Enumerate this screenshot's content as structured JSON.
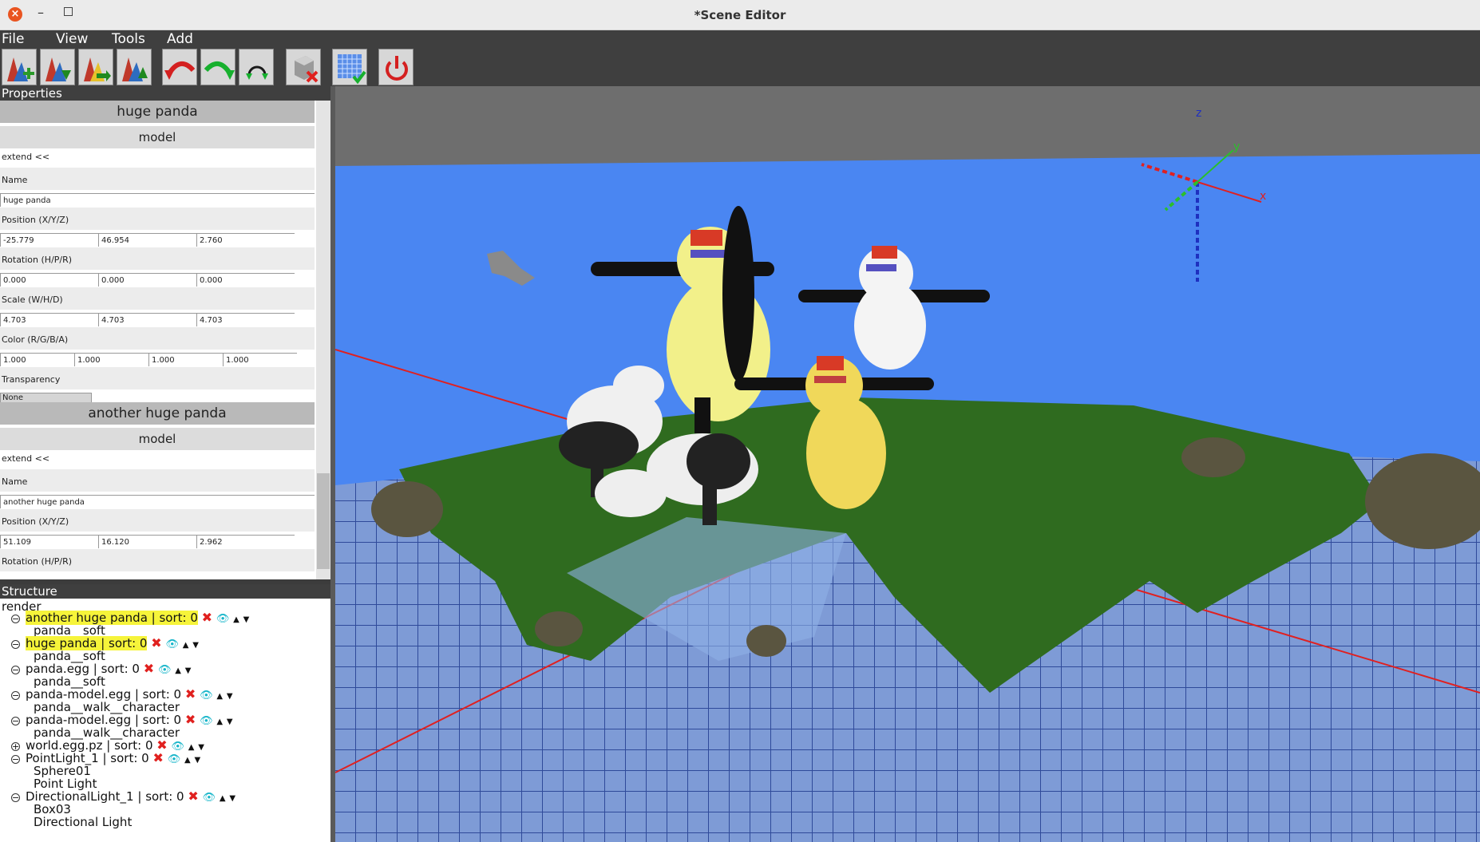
{
  "window": {
    "title": "*Scene Editor"
  },
  "menu": [
    "File",
    "View",
    "Tools",
    "Add"
  ],
  "toolbar": [
    {
      "name": "add-model-button",
      "icon": "add-model-icon"
    },
    {
      "name": "load-model-button",
      "icon": "load-model-icon"
    },
    {
      "name": "import-button",
      "icon": "import-icon"
    },
    {
      "name": "export-button",
      "icon": "export-icon"
    },
    {
      "name": "undo-button",
      "icon": "undo-icon"
    },
    {
      "name": "redo-button",
      "icon": "redo-icon"
    },
    {
      "name": "cycle-button",
      "icon": "cycle-icon"
    },
    {
      "name": "delete-object-button",
      "icon": "delete-cube-icon"
    },
    {
      "name": "toggle-grid-button",
      "icon": "grid-icon"
    },
    {
      "name": "quit-button",
      "icon": "power-icon"
    }
  ],
  "properties": {
    "header": "Properties",
    "objects": [
      {
        "title": "huge panda",
        "type": "model",
        "extend": "extend <<",
        "name_label": "Name",
        "name": "huge panda",
        "position_label": "Position (X/Y/Z)",
        "position": [
          "-25.779",
          "46.954",
          "2.760"
        ],
        "rotation_label": "Rotation (H/P/R)",
        "rotation": [
          "0.000",
          "0.000",
          "0.000"
        ],
        "scale_label": "Scale (W/H/D)",
        "scale": [
          "4.703",
          "4.703",
          "4.703"
        ],
        "color_label": "Color (R/G/B/A)",
        "color": [
          "1.000",
          "1.000",
          "1.000",
          "1.000"
        ],
        "transparency_label": "Transparency",
        "transparency": "None"
      },
      {
        "title": "another huge panda",
        "type": "model",
        "extend": "extend <<",
        "name_label": "Name",
        "name": "another huge panda",
        "position_label": "Position (X/Y/Z)",
        "position": [
          "51.109",
          "16.120",
          "2.962"
        ],
        "rotation_label": "Rotation (H/P/R)"
      }
    ]
  },
  "structure": {
    "header": "Structure",
    "root": "render",
    "nodes": [
      {
        "label": "another huge panda | sort: 0",
        "highlight": true,
        "child": [
          "panda__soft"
        ],
        "toggle": "−"
      },
      {
        "label": "huge panda | sort: 0",
        "highlight": true,
        "child": [
          "panda__soft"
        ],
        "toggle": "−"
      },
      {
        "label": "panda.egg | sort: 0",
        "highlight": false,
        "child": [
          "panda__soft"
        ],
        "toggle": "−"
      },
      {
        "label": "panda-model.egg | sort: 0",
        "highlight": false,
        "child": [
          "panda__walk__character"
        ],
        "toggle": "−"
      },
      {
        "label": "panda-model.egg | sort: 0",
        "highlight": false,
        "child": [
          "panda__walk__character"
        ],
        "toggle": "−"
      },
      {
        "label": "world.egg.pz | sort: 0",
        "highlight": false,
        "child": [],
        "toggle": "+"
      },
      {
        "label": "PointLight_1 | sort: 0",
        "highlight": false,
        "child": [
          "Sphere01",
          "Point Light"
        ],
        "toggle": "−"
      },
      {
        "label": "DirectionalLight_1 | sort: 0",
        "highlight": false,
        "child": [
          "Box03",
          "Directional Light"
        ],
        "toggle": "−"
      }
    ]
  },
  "viewport": {
    "axes": {
      "x": "x",
      "y": "y",
      "z": "z"
    },
    "colors": {
      "sky": "#6e6e6e",
      "water": "#4a86f2",
      "grid": "#2f4a9a",
      "terrain": "#2f6b1f"
    }
  }
}
